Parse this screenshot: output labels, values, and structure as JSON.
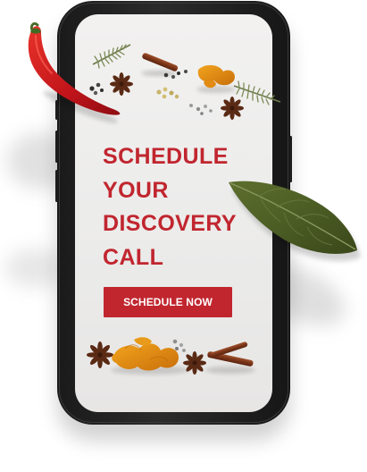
{
  "headline": {
    "line1": "SCHEDULE",
    "line2": "YOUR",
    "line3": "DISCOVERY",
    "line4": "CALL"
  },
  "cta": {
    "label": "SCHEDULE NOW"
  },
  "colors": {
    "accent": "#c1262f",
    "phone_frame": "#1f1f1f",
    "screen": "#eeedec"
  },
  "decorations": [
    "red-chili-icon",
    "rosemary-icon",
    "cinnamon-stick-icon",
    "star-anise-icon",
    "turmeric-root-icon",
    "peppercorn-icon",
    "bay-leaf-icon"
  ]
}
